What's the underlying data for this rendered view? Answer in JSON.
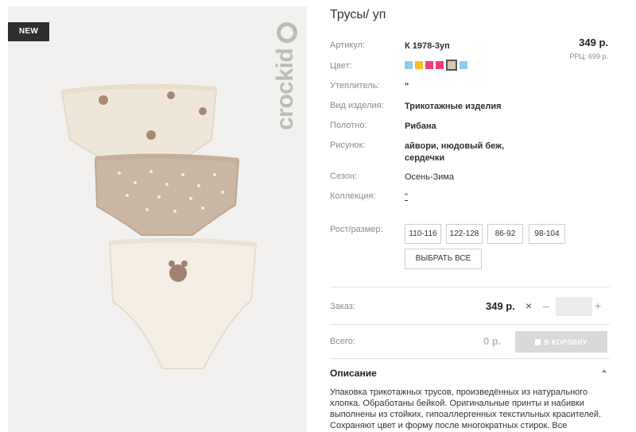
{
  "image": {
    "badge": "NEW",
    "brand": "crockid"
  },
  "product": {
    "title": "Трусы/ уп",
    "price": "349 р.",
    "rrp": "РРЦ: 699 р.",
    "specs": [
      {
        "label": "Артикул:",
        "value": "К 1978-3уп"
      },
      {
        "label": "Цвет:",
        "value": ""
      },
      {
        "label": "Утеплитель:",
        "value": "\""
      },
      {
        "label": "Вид изделия:",
        "value": "Трикотажные изделия"
      },
      {
        "label": "Полотно:",
        "value": "Рибана"
      },
      {
        "label": "Рисунок:",
        "value": "айвори, нюдовый беж, сердечки"
      },
      {
        "label": "Сезон:",
        "value": "Осень-Зима"
      },
      {
        "label": "Коллекция:",
        "value": "\""
      }
    ],
    "color_swatches": [
      "#8ecbf0",
      "#f6c023",
      "#ee3f7a",
      "#ef3d7c",
      "#d6c8b2",
      "#8ecbf0"
    ],
    "selected_swatch_index": 4
  },
  "sizes": {
    "label": "Рост/размер:",
    "options": [
      "110-116",
      "122-128",
      "86-92",
      "98-104"
    ],
    "select_all": "ВЫБРАТЬ ВСЕ"
  },
  "order": {
    "label": "Заказ:",
    "price": "349 р.",
    "times": "×",
    "minus": "–",
    "plus": "+",
    "quantity": ""
  },
  "total": {
    "label": "Всего:",
    "value": "0 р.",
    "cart_button": "В КОРЗИНУ"
  },
  "description": {
    "title": "Описание",
    "text": "Упаковка трикотажных трусов, произведённых из натурального хлопка. Обработаны бейкой. Оригинальные принты и набивки выполнены из стойких, гипоаллергенных текстильных красителей. Сохраняют цвет и форму после многократных стирок. Все"
  }
}
